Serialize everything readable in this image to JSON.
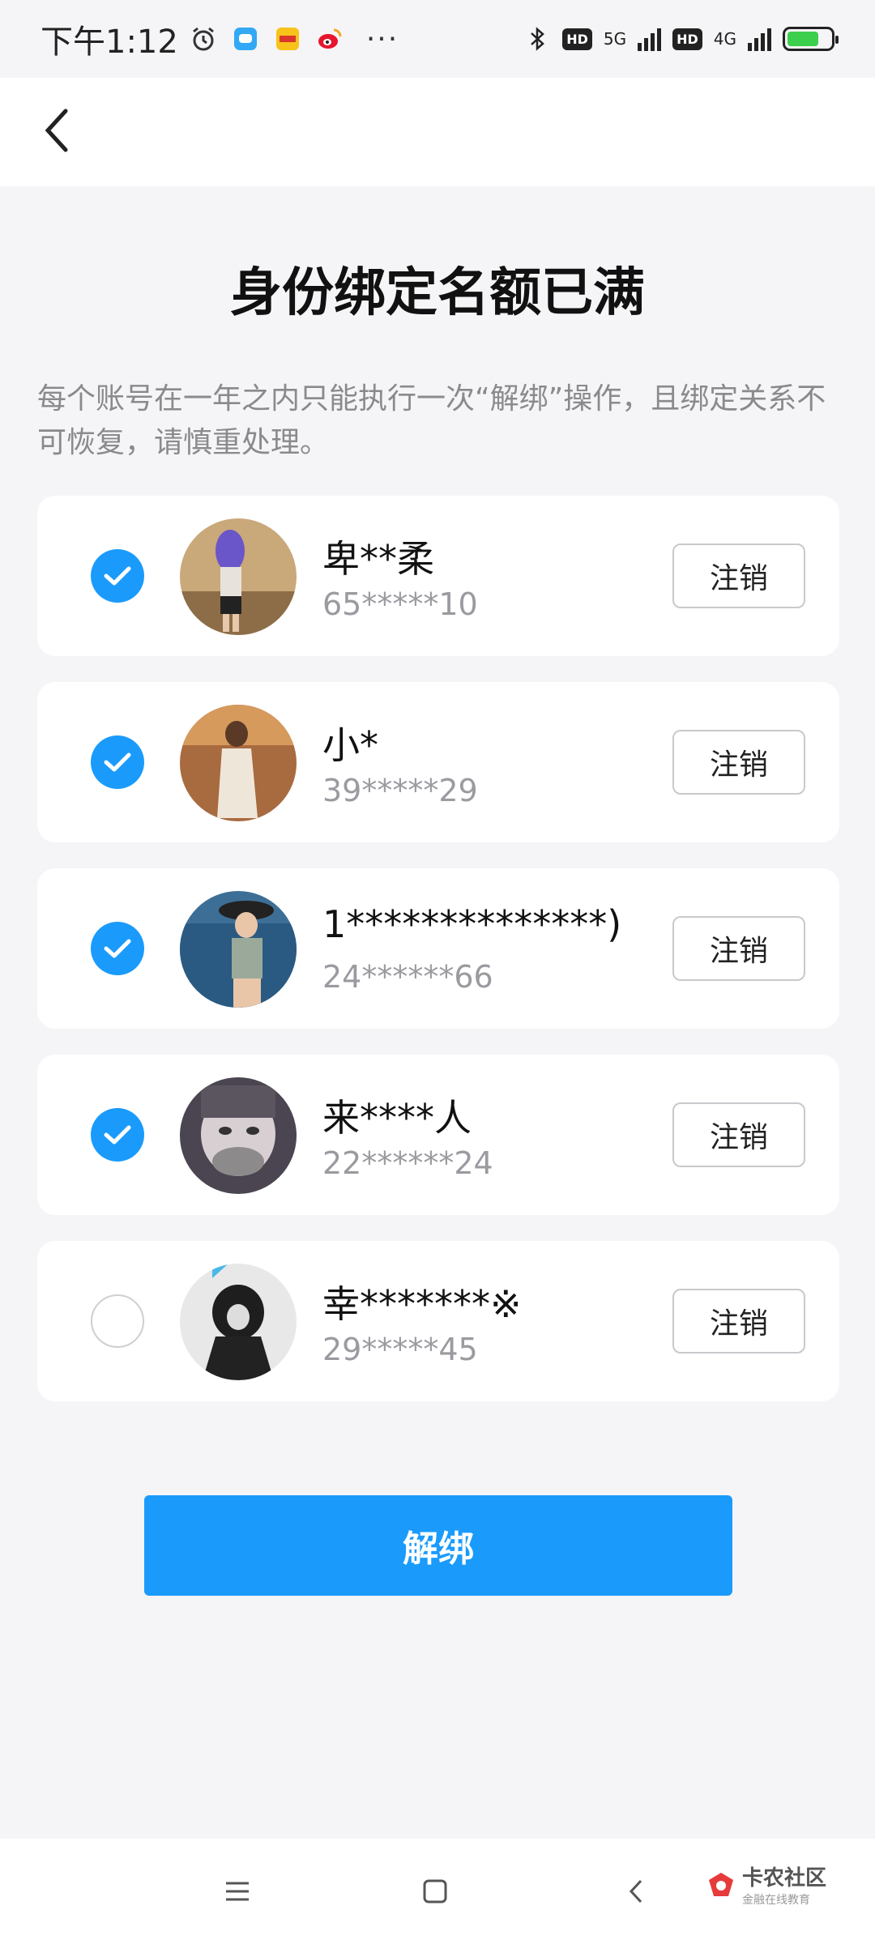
{
  "status_bar": {
    "time": "下午1:12",
    "net_5g": "5G",
    "net_4g": "4G",
    "hd": "HD",
    "more": "···"
  },
  "header": {
    "title": "身份绑定名额已满"
  },
  "description": "每个账号在一年之内只能执行一次“解绑”操作，且绑定关系不可恢复，请慎重处理。",
  "accounts": [
    {
      "name": "卑**柔",
      "uid": "65*****10",
      "checked": true,
      "cancel_label": "注销"
    },
    {
      "name": "小*",
      "uid": "39*****29",
      "checked": true,
      "cancel_label": "注销"
    },
    {
      "name": "1**************)",
      "uid": "24******66",
      "checked": true,
      "cancel_label": "注销"
    },
    {
      "name": "来****人",
      "uid": "22******24",
      "checked": true,
      "cancel_label": "注销"
    },
    {
      "name": "幸*******※",
      "uid": "29*****45",
      "checked": false,
      "cancel_label": "注销"
    }
  ],
  "primary_button": "解绑",
  "watermark": {
    "main": "卡农社区",
    "sub": "金融在线教育"
  },
  "colors": {
    "accent": "#1a9bfc",
    "background": "#f5f5f7"
  }
}
